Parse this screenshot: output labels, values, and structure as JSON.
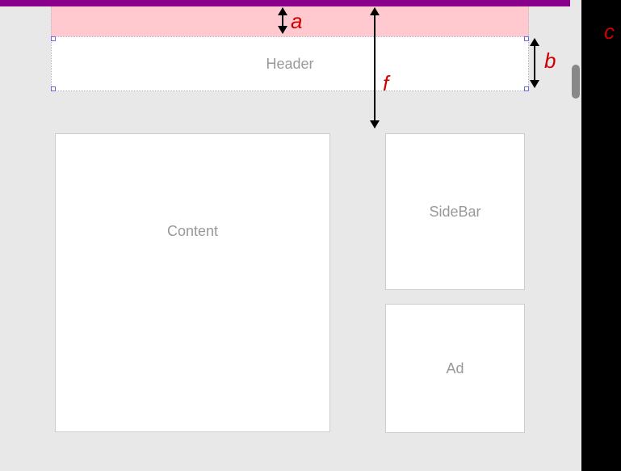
{
  "boxes": {
    "header": "Header",
    "content": "Content",
    "sidebar": "SideBar",
    "ad": "Ad"
  },
  "annotations": {
    "a": "a",
    "b": "b",
    "c": "c",
    "f": "f"
  }
}
